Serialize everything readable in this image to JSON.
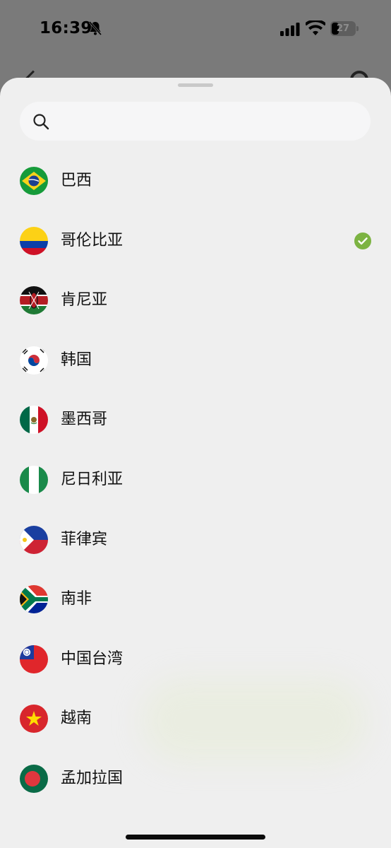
{
  "status_bar": {
    "time": "16:39",
    "battery": "27",
    "icons": [
      "bell-muted-icon",
      "signal-icon",
      "wifi-icon",
      "battery-icon"
    ]
  },
  "search": {
    "placeholder": "",
    "value": ""
  },
  "countries": [
    {
      "name": "巴西",
      "flag": "brazil-flag-icon",
      "selected": false
    },
    {
      "name": "哥伦比亚",
      "flag": "colombia-flag-icon",
      "selected": true
    },
    {
      "name": "肯尼亚",
      "flag": "kenya-flag-icon",
      "selected": false
    },
    {
      "name": "韩国",
      "flag": "south-korea-flag-icon",
      "selected": false
    },
    {
      "name": "墨西哥",
      "flag": "mexico-flag-icon",
      "selected": false
    },
    {
      "name": "尼日利亚",
      "flag": "nigeria-flag-icon",
      "selected": false
    },
    {
      "name": "菲律宾",
      "flag": "philippines-flag-icon",
      "selected": false
    },
    {
      "name": "南非",
      "flag": "south-africa-flag-icon",
      "selected": false
    },
    {
      "name": "中国台湾",
      "flag": "taiwan-flag-icon",
      "selected": false
    },
    {
      "name": "越南",
      "flag": "vietnam-flag-icon",
      "selected": false
    },
    {
      "name": "孟加拉国",
      "flag": "bangladesh-flag-icon",
      "selected": false
    }
  ],
  "colors": {
    "check": "#7cb342",
    "sheet_bg": "#efefef",
    "search_bg": "#f6f6f7"
  }
}
